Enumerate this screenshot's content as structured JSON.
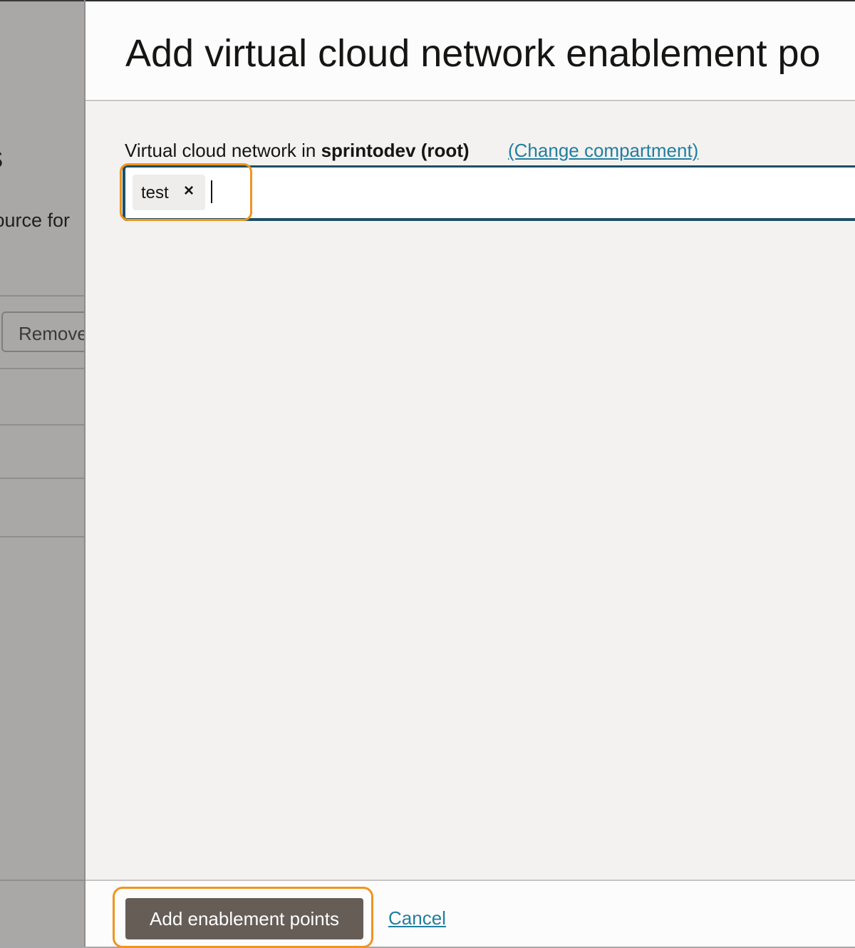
{
  "background_page": {
    "heading_fragment": "ts",
    "description_fragment": "source for",
    "remove_button_label": "Remove"
  },
  "drawer": {
    "title": "Add virtual cloud network enablement po",
    "vcn_field": {
      "label_prefix": "Virtual cloud network in ",
      "compartment": "sprintodev (root)",
      "change_link": "(Change compartment)",
      "selected_chip": "test",
      "chip_remove_glyph": "×"
    },
    "footer": {
      "primary_button": "Add enablement points",
      "cancel_link": "Cancel"
    }
  },
  "highlight_color": "#f0941e",
  "accent_link_color": "#227e9e"
}
